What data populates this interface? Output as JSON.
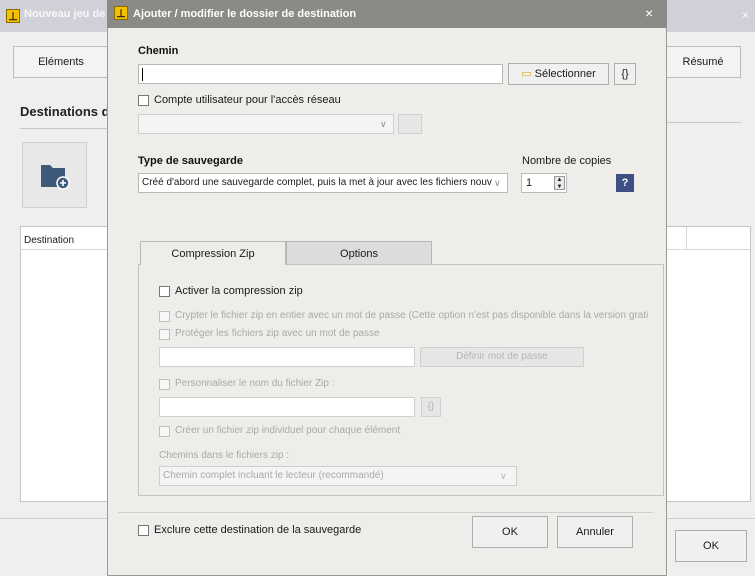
{
  "background": {
    "title": "Nouveau jeu de",
    "tabs": {
      "elements": "Eléments",
      "summary": "Résumé"
    },
    "section_title": "Destinations de",
    "table_header": "Destination",
    "ok_label": "OK",
    "close": "×"
  },
  "dialog": {
    "title": "Ajouter / modifier le dossier de destination",
    "close": "×",
    "path": {
      "label": "Chemin",
      "value": "",
      "select_button": "Sélectionner",
      "vars_button": "{}"
    },
    "network_account": {
      "label": "Compte utilisateur pour l'accès réseau",
      "checked": false
    },
    "backup_type": {
      "label": "Type de sauvegarde",
      "selected": "Créé d'abord une sauvegarde complet, puis la met à jour avec les fichiers nouveau"
    },
    "copies": {
      "label": "Nombre de copies",
      "value": "1"
    },
    "help": "?",
    "tabs": [
      "Compression Zip",
      "Options"
    ],
    "zip": {
      "enable": "Activer la compression zip",
      "encrypt": "Crypter le fichier zip en entier avec un mot de passe (Cette option n'est pas disponible dans la version grati",
      "protect": "Protéger les fichiers zip avec un mot de passe",
      "set_password": "Définir mot de passe",
      "customize_name": "Personnaliser le nom du fichier Zip :",
      "vars_button": "{}",
      "individual": "Créer un fichier zip individuel pour chaque élément",
      "paths_label": "Chemins dans le fichiers zip :",
      "paths_selected": "Chemin complet incluant le lecteur (recommandé)"
    },
    "exclude": "Exclure cette destination de la sauvegarde",
    "ok": "OK",
    "cancel": "Annuler"
  }
}
